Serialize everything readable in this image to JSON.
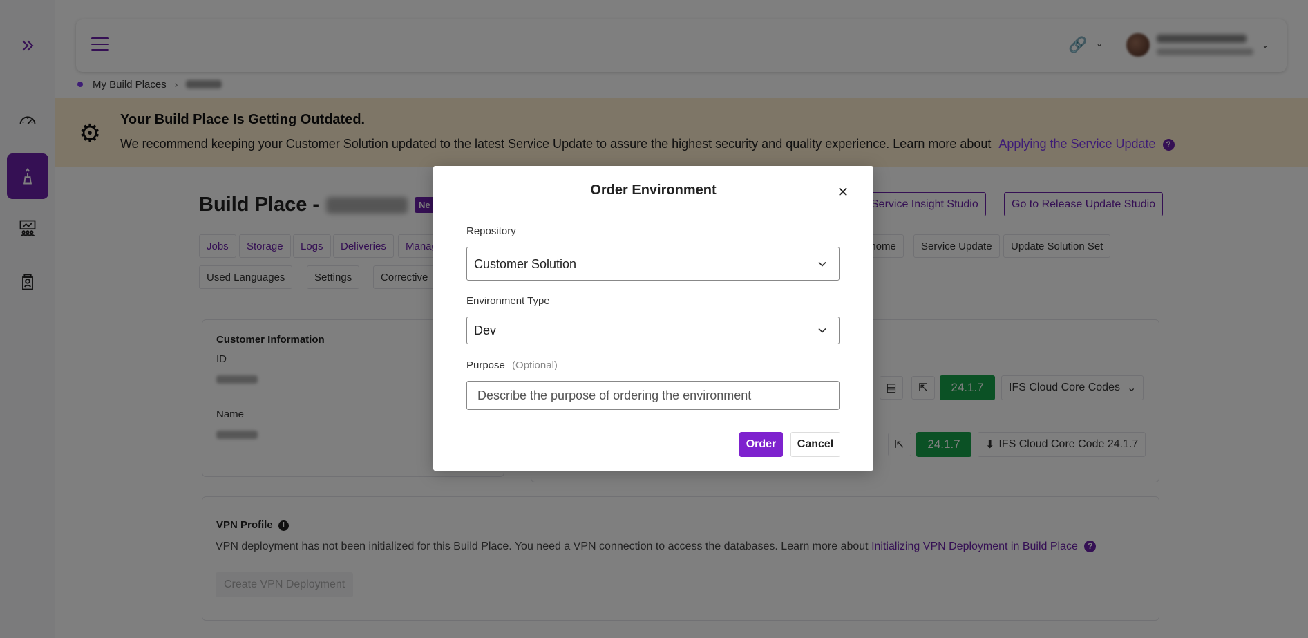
{
  "colors": {
    "brand_purple": "#6b21a8",
    "order_button": "#7e22ce",
    "version_green": "#16a34a",
    "banner_bg": "#fdeccf"
  },
  "rail": {
    "expand_icon": "double-chevron-right-icon",
    "items": [
      {
        "icon": "speedometer-icon"
      },
      {
        "icon": "build-place-icon",
        "active": true
      },
      {
        "icon": "people-chart-icon"
      },
      {
        "icon": "person-badge-icon"
      }
    ]
  },
  "header": {
    "menu_icon": "hamburger-icon",
    "link_icon": "link-icon"
  },
  "breadcrumb": {
    "root": "My Build Places",
    "separator": "›"
  },
  "banner": {
    "title": "Your Build Place Is Getting Outdated.",
    "text": "We recommend keeping your Customer Solution updated to the latest Service Update to assure the highest security and quality experience. Learn more about",
    "link": "Applying the Service Update",
    "help": "?"
  },
  "page": {
    "title_prefix": "Build Place -",
    "badge": "Ne",
    "btn_service_insight": "Service Insight Studio",
    "btn_release_update": "Go to Release Update Studio",
    "tabs_row1": [
      "Jobs",
      "Storage",
      "Logs",
      "Deliveries",
      "Manag"
    ],
    "tabs_row1_right": [
      "dhome",
      "Service Update",
      "Update Solution Set"
    ],
    "tabs_row2": [
      "Used Languages",
      "Settings",
      "Corrective"
    ],
    "customer_info": {
      "title": "Customer Information",
      "id_label": "ID",
      "name_label": "Name"
    },
    "versions": {
      "v1": "24.1.7",
      "v1_dropdown": "IFS Cloud Core Codes",
      "v2": "24.1.7",
      "v2_download": "IFS Cloud Core Code 24.1.7"
    },
    "vpn": {
      "title": "VPN Profile",
      "info": "i",
      "text": "VPN deployment has not been initialized for this Build Place. You need a VPN connection to access the databases. Learn more about",
      "link": "Initializing VPN Deployment in Build Place",
      "help": "?",
      "create_button": "Create VPN Deployment"
    }
  },
  "modal": {
    "title": "Order Environment",
    "close": "×",
    "repository_label": "Repository",
    "repository_value": "Customer Solution",
    "env_type_label": "Environment Type",
    "env_type_value": "Dev",
    "purpose_label": "Purpose",
    "purpose_optional": "(Optional)",
    "purpose_placeholder": "Describe the purpose of ordering the environment",
    "order_button": "Order",
    "cancel_button": "Cancel"
  }
}
